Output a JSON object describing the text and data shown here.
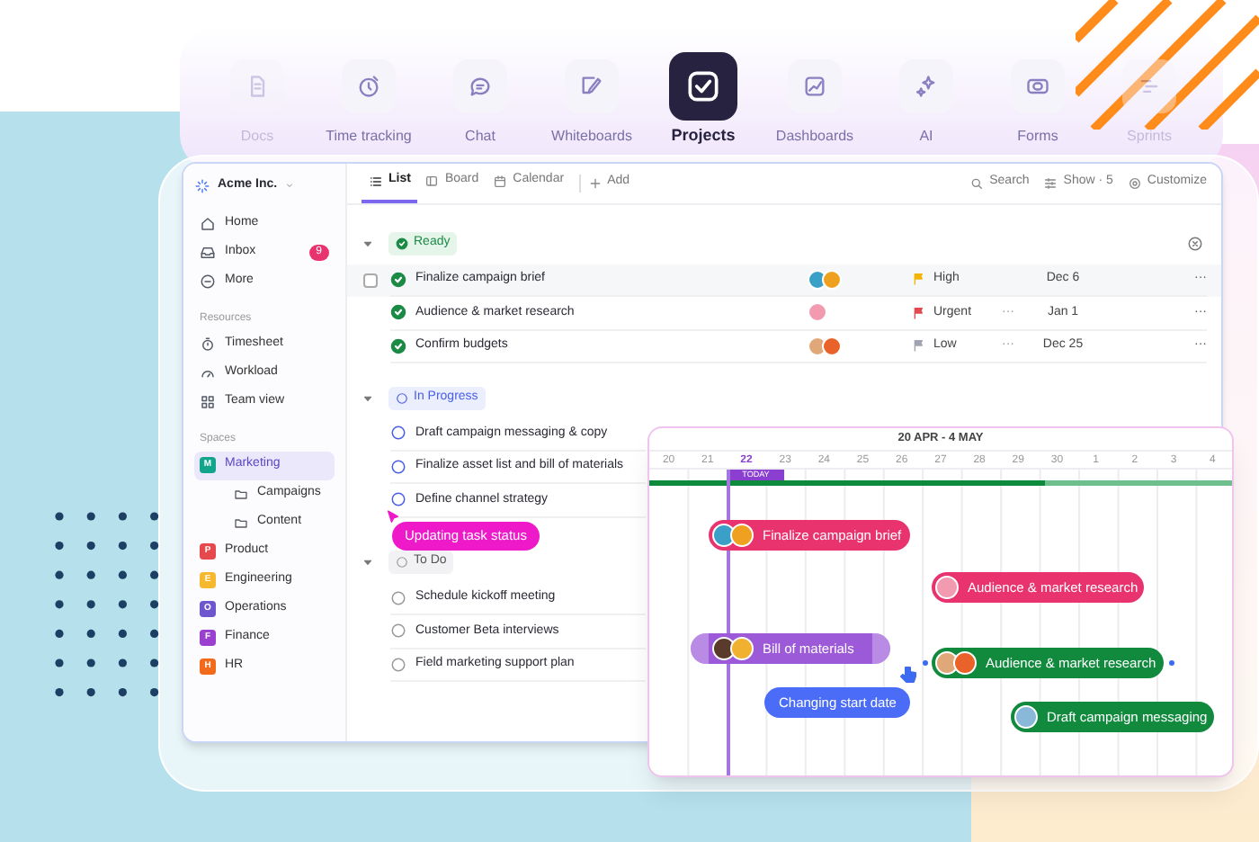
{
  "nav": [
    {
      "label": "Docs",
      "selected": false,
      "dimmed": true
    },
    {
      "label": "Time tracking",
      "selected": false,
      "dimmed": false
    },
    {
      "label": "Chat",
      "selected": false,
      "dimmed": false
    },
    {
      "label": "Whiteboards",
      "selected": false,
      "dimmed": false
    },
    {
      "label": "Projects",
      "selected": true,
      "dimmed": false
    },
    {
      "label": "Dashboards",
      "selected": false,
      "dimmed": false
    },
    {
      "label": "AI",
      "selected": false,
      "dimmed": false
    },
    {
      "label": "Forms",
      "selected": false,
      "dimmed": false
    },
    {
      "label": "Sprints",
      "selected": false,
      "dimmed": true
    }
  ],
  "workspace": {
    "name": "Acme Inc."
  },
  "sidebar": {
    "top_items": [
      {
        "label": "Home"
      },
      {
        "label": "Inbox",
        "badge": "9"
      },
      {
        "label": "More"
      }
    ],
    "resources": {
      "title": "Resources",
      "items": [
        {
          "label": "Timesheet"
        },
        {
          "label": "Workload"
        },
        {
          "label": "Team view"
        }
      ]
    },
    "spaces": {
      "title": "Spaces",
      "items": [
        {
          "label": "Marketing",
          "initial": "M",
          "color": "#12a58c",
          "selected": true,
          "children": [
            {
              "label": "Campaigns"
            },
            {
              "label": "Content"
            }
          ]
        },
        {
          "label": "Product",
          "initial": "P",
          "color": "#e5484d",
          "selected": false
        },
        {
          "label": "Engineering",
          "initial": "E",
          "color": "#f5b82e",
          "selected": false
        },
        {
          "label": "Operations",
          "initial": "O",
          "color": "#6e56cf",
          "selected": false
        },
        {
          "label": "Finance",
          "initial": "F",
          "color": "#9b3fd0",
          "selected": false
        },
        {
          "label": "HR",
          "initial": "H",
          "color": "#f26b1d",
          "selected": false
        }
      ]
    }
  },
  "toolbar": {
    "views": [
      {
        "label": "List",
        "selected": true
      },
      {
        "label": "Board",
        "selected": false
      },
      {
        "label": "Calendar",
        "selected": false
      }
    ],
    "add": "Add",
    "search": "Search",
    "show": "Show · 5",
    "customize": "Customize"
  },
  "groups": [
    {
      "status": "Ready",
      "kind": "done",
      "tasks": [
        {
          "name": "Finalize campaign brief",
          "selected": true,
          "assignees": [
            {
              "color": "#3aa0c8"
            },
            {
              "color": "#f0a020"
            }
          ],
          "priority": {
            "label": "High",
            "color": "#f5b400"
          },
          "date": "Dec 6",
          "menu": "···"
        },
        {
          "name": "Audience & market research",
          "selected": false,
          "assignees": [
            {
              "color": "#f29bb0"
            }
          ],
          "priority": {
            "label": "Urgent",
            "color": "#e5484d"
          },
          "column_5": "···",
          "date": "Jan 1",
          "menu": "···"
        },
        {
          "name": "Confirm budgets",
          "selected": false,
          "assignees": [
            {
              "color": "#e0a878"
            },
            {
              "color": "#e8622a"
            }
          ],
          "priority": {
            "label": "Low",
            "color": "#a0a4b0"
          },
          "column_5": "···",
          "date": "Dec 25",
          "menu": "···"
        }
      ]
    },
    {
      "status": "In Progress",
      "kind": "progress",
      "tasks": [
        {
          "name": "Draft campaign messaging & copy"
        },
        {
          "name": "Finalize asset list and bill of materials"
        },
        {
          "name": "Define channel strategy"
        }
      ]
    },
    {
      "status": "To Do",
      "kind": "todo",
      "tasks": [
        {
          "name": "Schedule kickoff meeting"
        },
        {
          "name": "Customer Beta interviews"
        },
        {
          "name": "Field marketing support plan"
        }
      ]
    }
  ],
  "status_tooltip": "Updating task status",
  "gantt": {
    "range": "20 APR - 4 MAY",
    "today_label": "TODAY",
    "days": [
      {
        "label": "20",
        "selected": false
      },
      {
        "label": "21",
        "selected": false
      },
      {
        "label": "22",
        "selected": true
      },
      {
        "label": "23",
        "selected": false
      },
      {
        "label": "24",
        "selected": false
      },
      {
        "label": "25",
        "selected": false
      },
      {
        "label": "26",
        "selected": false
      },
      {
        "label": "27",
        "selected": false
      },
      {
        "label": "28",
        "selected": false
      },
      {
        "label": "29",
        "selected": false
      },
      {
        "label": "30",
        "selected": false
      },
      {
        "label": "1",
        "selected": false
      },
      {
        "label": "2",
        "selected": false
      },
      {
        "label": "3",
        "selected": false
      },
      {
        "label": "4",
        "selected": false
      }
    ],
    "progress": {
      "level": 0.68
    },
    "bars": [
      {
        "name": "Finalize campaign brief",
        "color": "#e8336f",
        "kind": "plain",
        "assignees": [
          {
            "color": "#3aa0c8"
          },
          {
            "color": "#f0a020"
          }
        ]
      },
      {
        "name": "Audience & market research",
        "color": "#e8336f",
        "kind": "plain",
        "assignees": [
          {
            "color": "#f29bb0"
          }
        ]
      },
      {
        "name": "Bill of materials",
        "color": "#9d5ad8",
        "kind": "resizable",
        "assignees": [
          {
            "color": "#5a3a2a"
          },
          {
            "color": "#f0b030"
          }
        ]
      },
      {
        "name": "Audience & market research",
        "color": "#118a3e",
        "kind": "dragging",
        "assignees": [
          {
            "color": "#e0a878"
          },
          {
            "color": "#e8622a"
          }
        ]
      },
      {
        "name": "Draft campaign messaging",
        "color": "#118a3e",
        "kind": "plain",
        "assignees": [
          {
            "color": "#8ab8d8"
          }
        ]
      }
    ],
    "tooltip": "Changing start date"
  }
}
